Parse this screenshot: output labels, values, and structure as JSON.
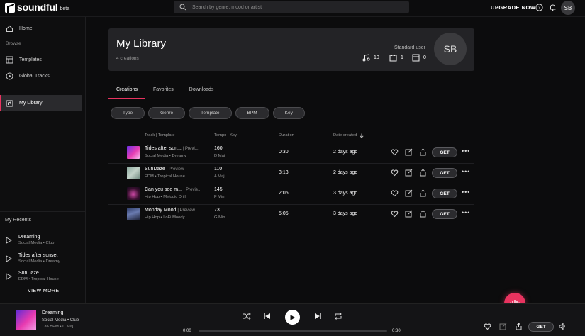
{
  "brand": {
    "name": "soundful",
    "tag": "beta"
  },
  "search": {
    "placeholder": "Search by genre, mood or artist"
  },
  "top": {
    "upgrade": "UPGRADE NOW",
    "avatar": "SB"
  },
  "sidebar": {
    "home": "Home",
    "browse_label": "Browse",
    "templates": "Templates",
    "global_tracks": "Global Tracks",
    "my_library": "My Library"
  },
  "recents": {
    "title": "My Recents",
    "items": [
      {
        "title": "Dreaming",
        "sub": "Social Media • Club"
      },
      {
        "title": "Tides after sunset",
        "sub": "Social Media • Dreamy"
      },
      {
        "title": "SunDaze",
        "sub": "EDM • Tropical House"
      }
    ],
    "view_more": "VIEW MORE"
  },
  "library": {
    "title": "My Library",
    "count": "4 creations",
    "plan": "Standard user",
    "stats": {
      "tracks": "10",
      "calendar": "1",
      "downloads": "0"
    },
    "avatar": "SB"
  },
  "tabs": [
    "Creations",
    "Favorites",
    "Downloads"
  ],
  "filters": [
    "Type",
    "Genre",
    "Template",
    "BPM",
    "Key"
  ],
  "table": {
    "headers": {
      "track": "Track | Template",
      "tempo": "Tempo | Key",
      "duration": "Duration",
      "date": "Date created"
    },
    "rows": [
      {
        "title": "Tides after sun...",
        "preview": "| Previ...",
        "sub": "Social Media • Dreamy",
        "bpm": "160",
        "key": "D Maj",
        "duration": "0:30",
        "date": "2 days ago",
        "get": "GET"
      },
      {
        "title": "SunDaze",
        "preview": "| Preview",
        "sub": "EDM • Tropical House",
        "bpm": "110",
        "key": "A Maj",
        "duration": "3:13",
        "date": "2 days ago",
        "get": "GET"
      },
      {
        "title": "Can you see m...",
        "preview": "| Previe...",
        "sub": "Hip Hop • Melodic Drill",
        "bpm": "145",
        "key": "F Min",
        "duration": "2:05",
        "date": "3 days ago",
        "get": "GET"
      },
      {
        "title": "Monday Mood",
        "preview": "| Preview",
        "sub": "Hip Hop • LoFi Moody",
        "bpm": "73",
        "key": "G Min",
        "duration": "5:05",
        "date": "3 days ago",
        "get": "GET"
      }
    ]
  },
  "player": {
    "title": "Dreaming",
    "sub": "Social Media • Club",
    "meta": "136 BPM • D Maj",
    "current": "0:00",
    "total": "0:30",
    "progress": 0,
    "get": "GET"
  },
  "colors": {
    "accent": "#e8335f",
    "panel": "#232326",
    "bg": "#0c0c0d"
  }
}
